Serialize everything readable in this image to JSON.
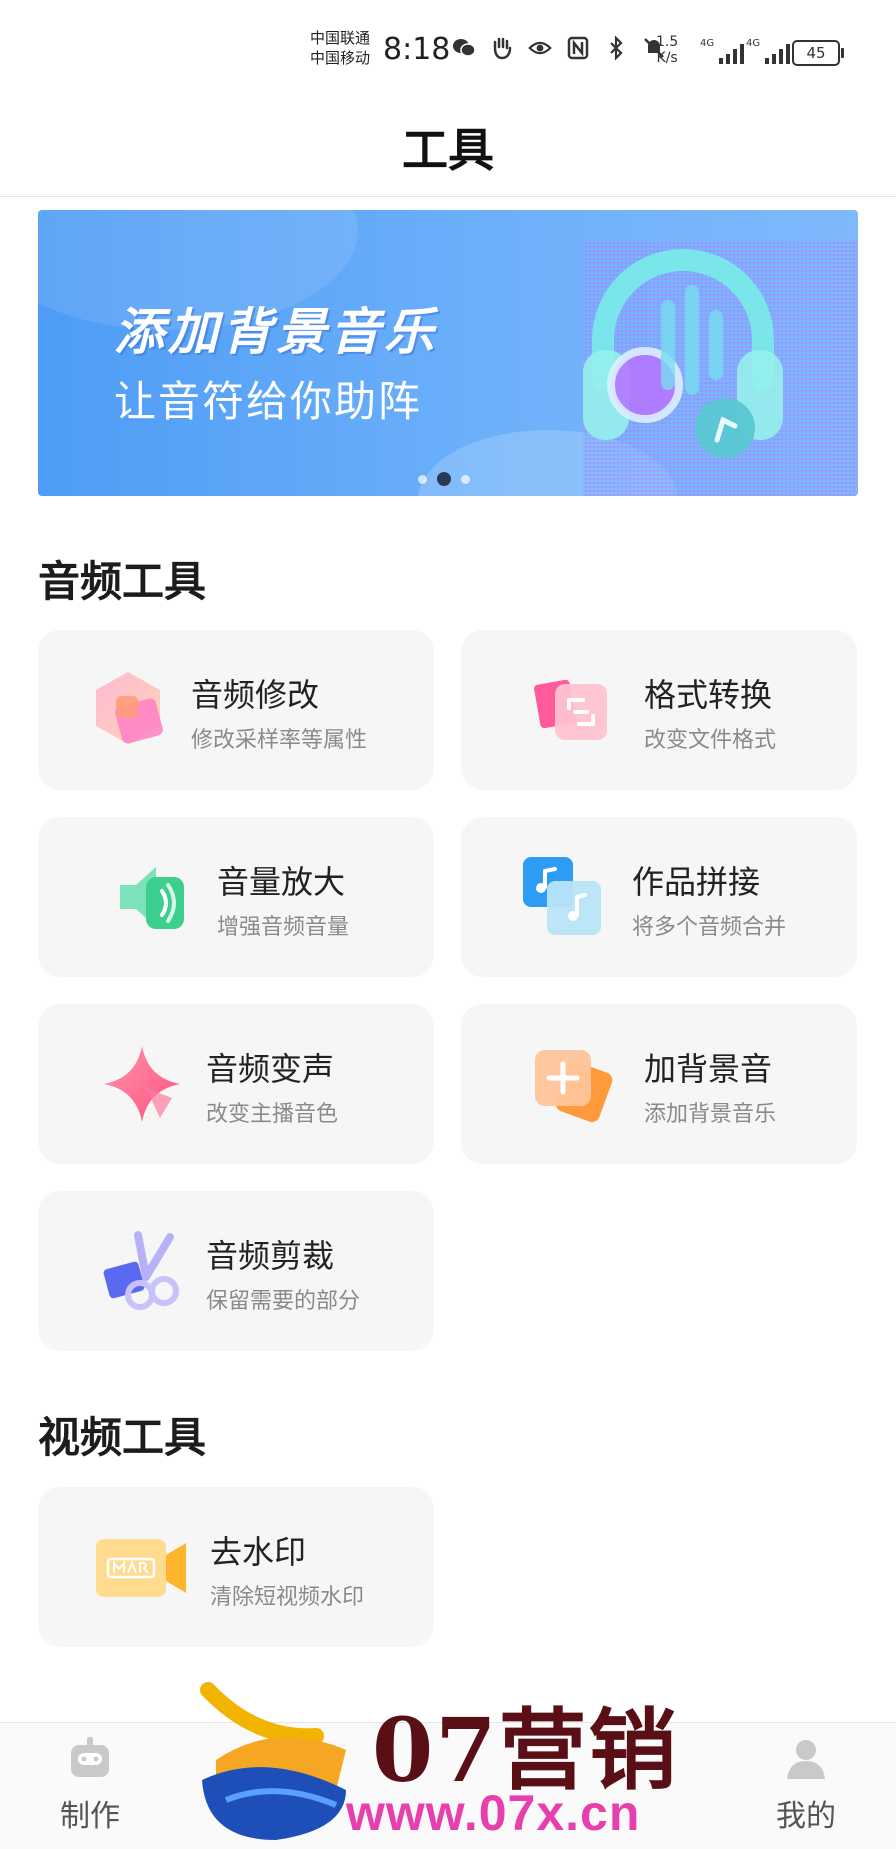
{
  "status_bar": {
    "carrier_1": "中国联通",
    "carrier_2": "中国移动",
    "time": "8:18",
    "net_speed_value": "1.5",
    "net_speed_unit": "K/s",
    "signal_1": "4G",
    "signal_2": "4G",
    "battery": "45"
  },
  "header": {
    "title": "工具"
  },
  "banner": {
    "title": "添加背景音乐",
    "subtitle": "让音符给你助阵",
    "pages": 3,
    "active_page": 2
  },
  "audio_section": {
    "title": "音频工具",
    "tools": [
      {
        "name": "音频修改",
        "desc": "修改采样率等属性",
        "icon": "audio-edit-icon"
      },
      {
        "name": "格式转换",
        "desc": "改变文件格式",
        "icon": "format-convert-icon"
      },
      {
        "name": "音量放大",
        "desc": "增强音频音量",
        "icon": "volume-boost-icon"
      },
      {
        "name": "作品拼接",
        "desc": "将多个音频合并",
        "icon": "merge-icon"
      },
      {
        "name": "音频变声",
        "desc": "改变主播音色",
        "icon": "voice-change-icon"
      },
      {
        "name": "加背景音",
        "desc": "添加背景音乐",
        "icon": "add-bgm-icon"
      },
      {
        "name": "音频剪裁",
        "desc": "保留需要的部分",
        "icon": "audio-trim-icon"
      }
    ]
  },
  "video_section": {
    "title": "视频工具",
    "tools": [
      {
        "name": "去水印",
        "desc": "清除短视频水印",
        "icon": "remove-watermark-icon"
      }
    ]
  },
  "bottom_nav": {
    "items": [
      {
        "label": "制作",
        "icon": "robot-icon"
      },
      {
        "label": "我的",
        "icon": "profile-icon"
      }
    ]
  },
  "watermark": {
    "brand": "07营销",
    "url": "www.07x.cn"
  },
  "colors": {
    "banner": "#5ba5f8",
    "card_bg": "#f6f6f6",
    "watermark_url": "#e83fae",
    "watermark_brand": "#5a0f17"
  }
}
